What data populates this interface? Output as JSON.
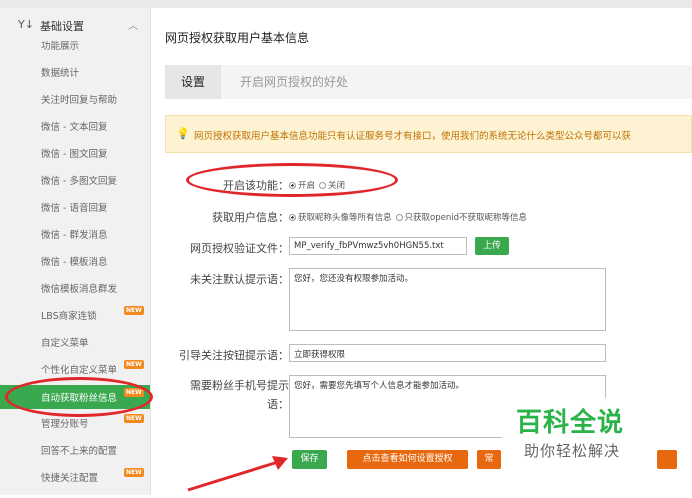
{
  "sidebar": {
    "section_title": "基础设置",
    "section_icon": "settings-icon",
    "items": [
      {
        "label": "功能展示",
        "new": false,
        "active": false
      },
      {
        "label": "数据统计",
        "new": false,
        "active": false
      },
      {
        "label": "关注时回复与帮助",
        "new": false,
        "active": false
      },
      {
        "label": "微信 - 文本回复",
        "new": false,
        "active": false
      },
      {
        "label": "微信 - 图文回复",
        "new": false,
        "active": false
      },
      {
        "label": "微信 - 多图文回复",
        "new": false,
        "active": false
      },
      {
        "label": "微信 - 语音回复",
        "new": false,
        "active": false
      },
      {
        "label": "微信 - 群发消息",
        "new": false,
        "active": false
      },
      {
        "label": "微信 - 模板消息",
        "new": false,
        "active": false
      },
      {
        "label": "微信模板消息群发",
        "new": false,
        "active": false
      },
      {
        "label": "LBS商家连锁",
        "new": true,
        "active": false
      },
      {
        "label": "自定义菜单",
        "new": false,
        "active": false
      },
      {
        "label": "个性化自定义菜单",
        "new": true,
        "active": false
      },
      {
        "label": "自动获取粉丝信息",
        "new": true,
        "active": true
      },
      {
        "label": "管理分账号",
        "new": true,
        "active": false
      },
      {
        "label": "回答不上来的配置",
        "new": false,
        "active": false
      },
      {
        "label": "快捷关注配置",
        "new": true,
        "active": false
      }
    ],
    "new_badge": "NEW"
  },
  "main": {
    "title": "网页授权获取用户基本信息",
    "tabs": [
      {
        "label": "设置",
        "active": true
      },
      {
        "label": "开启网页授权的好处",
        "active": false
      }
    ],
    "notice": "网页授权获取用户基本信息功能只有认证服务号才有接口，使用我们的系统无论什么类型公众号都可以获",
    "form": {
      "enable_label": "开启该功能：",
      "enable_options": [
        "开启",
        "关闭"
      ],
      "enable_selected": "开启",
      "userinfo_label": "获取用户信息：",
      "userinfo_options": [
        "获取昵称头像等所有信息",
        "只获取openid不获取昵称等信息"
      ],
      "userinfo_selected": "获取昵称头像等所有信息",
      "verify_file_label": "网页授权验证文件：",
      "verify_file_value": "MP_verify_fbPVmwz5vh0HGN55.txt",
      "upload_button": "上传",
      "unfollow_tip_label": "未关注默认提示语：",
      "unfollow_tip_value": "您好，您还没有权限参加活动。",
      "guide_button_label": "引导关注按钮提示语：",
      "guide_button_value": "立即获得权限",
      "phone_tip_label_1": "需要粉丝手机号提示",
      "phone_tip_label_2": "语：",
      "phone_tip_value": "您好，需要您先填写个人信息才能参加活动。"
    },
    "buttons": {
      "save": "保存",
      "howto": "点击查看如何设置授权",
      "third": "常"
    }
  },
  "watermark": {
    "title": "百科全说",
    "subtitle": "助你轻松解决"
  },
  "colors": {
    "accent_green": "#3aa84f",
    "accent_orange": "#e8680f",
    "annotation_red": "#e0282b",
    "notice_bg": "#fdf3d3"
  }
}
